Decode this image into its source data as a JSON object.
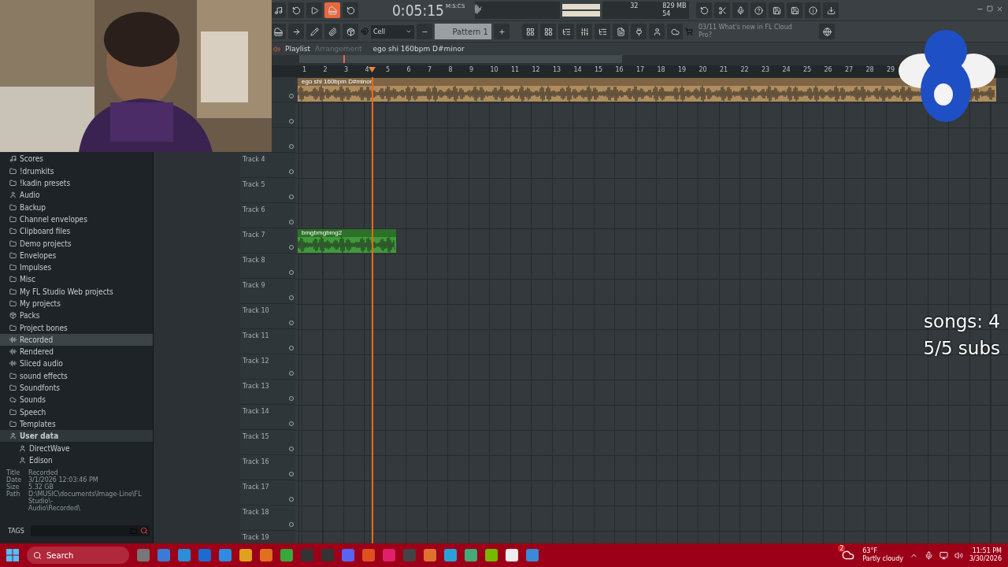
{
  "webcam": {
    "kind": "picture"
  },
  "toolbar": {
    "mode_buttons": [
      {
        "on": false
      },
      {
        "on": false
      },
      {
        "on": false
      },
      {
        "on": true
      },
      {
        "on": false
      }
    ],
    "time": "0:05:15",
    "time_unit": "M:S:CS",
    "cpu": "32",
    "memory": "829 MB",
    "polyphony": "54",
    "snap": "Cell",
    "pattern": "Pattern 1",
    "news_date": "03/11",
    "news": "What's new in FL Cloud Pro?"
  },
  "playlist": {
    "title": "Playlist",
    "mode": "Arrangement",
    "arrangement": "ego shi 160bpm D#minor",
    "ruler": [
      "1",
      "2",
      "3",
      "4",
      "5",
      "6",
      "7",
      "8",
      "9",
      "10",
      "11",
      "12",
      "13",
      "14",
      "15",
      "16",
      "17",
      "18",
      "19",
      "20",
      "21",
      "22",
      "23",
      "24",
      "25",
      "26",
      "27",
      "28",
      "29"
    ],
    "tracks": [
      {
        "kind": "covered",
        "clip": {
          "name": "ego shi 160bpm D#minor",
          "color": "#b08d5e",
          "kind": "long"
        }
      },
      {
        "kind": "covered"
      },
      {
        "kind": "covered"
      },
      {
        "kind": "named",
        "label": "Track 4"
      },
      {
        "kind": "named",
        "label": "Track 5"
      },
      {
        "kind": "named",
        "label": "Track 6"
      },
      {
        "kind": "named",
        "label": "Track 7",
        "clip": {
          "name": "bmgbmgbmg2",
          "color": "#3f9b3a",
          "kind": "short"
        }
      },
      {
        "kind": "named",
        "label": "Track 8"
      },
      {
        "kind": "named",
        "label": "Track 9"
      },
      {
        "kind": "named",
        "label": "Track 10"
      },
      {
        "kind": "named",
        "label": "Track 11"
      },
      {
        "kind": "named",
        "label": "Track 12"
      },
      {
        "kind": "named",
        "label": "Track 13"
      },
      {
        "kind": "named",
        "label": "Track 14"
      },
      {
        "kind": "named",
        "label": "Track 15"
      },
      {
        "kind": "named",
        "label": "Track 16"
      },
      {
        "kind": "named",
        "label": "Track 17"
      },
      {
        "kind": "named",
        "label": "Track 18"
      },
      {
        "kind": "named",
        "label": "Track 19"
      }
    ]
  },
  "browser": {
    "items": [
      {
        "kind": "note",
        "label": "Scores",
        "selected": false
      },
      {
        "kind": "folder",
        "label": "!drumkits",
        "selected": false
      },
      {
        "kind": "folder",
        "label": "!kadin presets",
        "selected": false
      },
      {
        "kind": "user",
        "label": "Audio",
        "selected": false
      },
      {
        "kind": "folder",
        "label": "Backup",
        "selected": false
      },
      {
        "kind": "folder",
        "label": "Channel envelopes",
        "selected": false
      },
      {
        "kind": "folder",
        "label": "Clipboard files",
        "selected": false
      },
      {
        "kind": "folder",
        "label": "Demo projects",
        "selected": false
      },
      {
        "kind": "folder",
        "label": "Envelopes",
        "selected": false
      },
      {
        "kind": "folder",
        "label": "Impulses",
        "selected": false
      },
      {
        "kind": "folder",
        "label": "Misc",
        "selected": false
      },
      {
        "kind": "folder",
        "label": "My FL Studio Web projects",
        "selected": false
      },
      {
        "kind": "folder",
        "label": "My projects",
        "selected": false
      },
      {
        "kind": "pack",
        "label": "Packs",
        "selected": false
      },
      {
        "kind": "folder",
        "label": "Project bones",
        "selected": false
      },
      {
        "kind": "wave",
        "label": "Recorded",
        "selected": true
      },
      {
        "kind": "wave",
        "label": "Rendered",
        "selected": false
      },
      {
        "kind": "wave",
        "label": "Sliced audio",
        "selected": false
      },
      {
        "kind": "folder",
        "label": "sound effects",
        "selected": false
      },
      {
        "kind": "folder",
        "label": "Soundfonts",
        "selected": false
      },
      {
        "kind": "cloud",
        "label": "Sounds",
        "selected": false
      },
      {
        "kind": "folder",
        "label": "Speech",
        "selected": false
      },
      {
        "kind": "folder",
        "label": "Templates",
        "selected": false
      },
      {
        "kind": "user",
        "label": "User data",
        "selected": false,
        "expanded": true,
        "children": [
          {
            "kind": "user",
            "label": "DirectWave",
            "selected": false
          },
          {
            "kind": "user",
            "label": "Edison",
            "selected": false
          }
        ]
      }
    ],
    "info": [
      {
        "key": "Title",
        "value": "Recorded"
      },
      {
        "key": "Date",
        "value": "3/1/2026 12:03:46 PM"
      },
      {
        "key": "Size",
        "value": "5.32 GB"
      },
      {
        "key": "Path",
        "lines": [
          "D:\\MUSIC\\documents\\Image-Line\\FL Studio\\-",
          "Audio\\Recorded\\"
        ]
      }
    ],
    "tags": "TAGS"
  },
  "overlay": [
    "songs: 4",
    "5/5 subs"
  ],
  "mascot": {
    "kind": "picture"
  },
  "taskbar": {
    "search": "Search",
    "weather_badge": "2",
    "temperature": "63°F",
    "weather": "Partly cloudy",
    "time": "11:51 PM",
    "date": "3/30/2026"
  }
}
